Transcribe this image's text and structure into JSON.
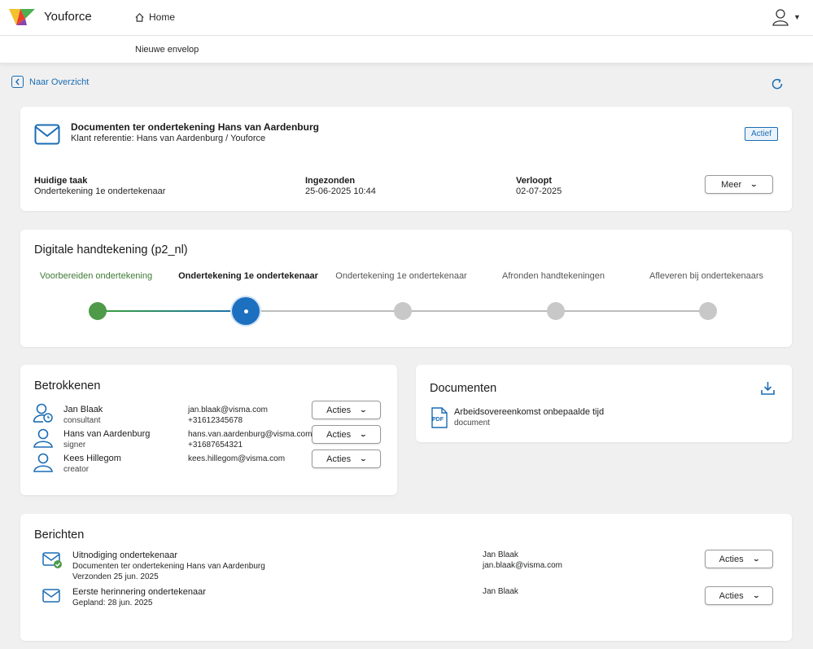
{
  "header": {
    "brand": "Youforce",
    "home_label": "Home",
    "sub_nav": "Nieuwe envelop"
  },
  "back_label": "Naar Overzicht",
  "envelope": {
    "title": "Documenten ter ondertekening Hans van Aardenburg",
    "reference": "Klant referentie: Hans van Aardenburg / Youforce",
    "status": "Actief",
    "current_task_label": "Huidige taak",
    "current_task": "Ondertekening 1e ondertekenaar",
    "sent_label": "Ingezonden",
    "sent": "25-06-2025 10:44",
    "expires_label": "Verloopt",
    "expires": "02-07-2025",
    "more_label": "Meer"
  },
  "workflow": {
    "title": "Digitale handtekening (p2_nl)",
    "steps": [
      {
        "label": "Voorbereiden ondertekening",
        "state": "done"
      },
      {
        "label": "Ondertekening 1e ondertekenaar",
        "state": "active"
      },
      {
        "label": "Ondertekening 1e ondertekenaar",
        "state": "todo"
      },
      {
        "label": "Afronden handtekeningen",
        "state": "todo"
      },
      {
        "label": "Afleveren bij ondertekenaars",
        "state": "todo"
      }
    ]
  },
  "participants": {
    "title": "Betrokkenen",
    "action_label": "Acties",
    "items": [
      {
        "name": "Jan Blaak",
        "role": "consultant",
        "email": "jan.blaak@visma.com",
        "phone": "+31612345678"
      },
      {
        "name": "Hans van Aardenburg",
        "role": "signer",
        "email": "hans.van.aardenburg@visma.com",
        "phone": "+31687654321"
      },
      {
        "name": "Kees Hillegom",
        "role": "creator",
        "email": "kees.hillegom@visma.com",
        "phone": ""
      }
    ]
  },
  "documents": {
    "title": "Documenten",
    "items": [
      {
        "name": "Arbeidsovereenkomst onbepaalde tijd",
        "type": "document",
        "icon": "pdf-icon"
      }
    ]
  },
  "messages": {
    "title": "Berichten",
    "action_label": "Acties",
    "items": [
      {
        "title": "Uitnodiging ondertekenaar",
        "subject": "Documenten ter ondertekening Hans van Aardenburg",
        "status": "Verzonden 25 jun. 2025",
        "sender": "Jan Blaak",
        "sender_email": "jan.blaak@visma.com"
      },
      {
        "title": "Eerste herinnering ondertekenaar",
        "subject": "",
        "status": "Gepland: 28 jun. 2025",
        "sender": "Jan Blaak",
        "sender_email": ""
      }
    ]
  },
  "colors": {
    "accent": "#1a6db5",
    "done": "#4e9a49",
    "pending": "#c8c8c8"
  }
}
